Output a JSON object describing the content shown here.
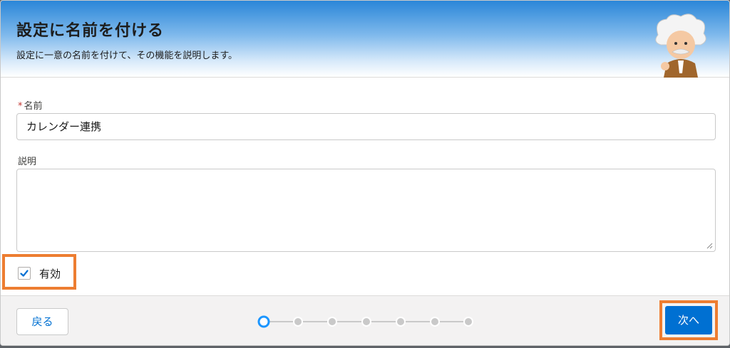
{
  "header": {
    "title": "設定に名前を付ける",
    "subtitle": "設定に一意の名前を付けて、その機能を説明します。"
  },
  "form": {
    "name": {
      "required_mark": "*",
      "label": "名前",
      "value": "カレンダー連携"
    },
    "description": {
      "label": "説明",
      "value": ""
    },
    "enabled": {
      "label": "有効",
      "checked": true
    }
  },
  "footer": {
    "back_label": "戻る",
    "next_label": "次へ",
    "progress": {
      "total_steps": 7,
      "current_step": 1
    }
  },
  "colors": {
    "accent": "#0070d2",
    "highlight": "#ed7d31",
    "required": "#c23934"
  }
}
